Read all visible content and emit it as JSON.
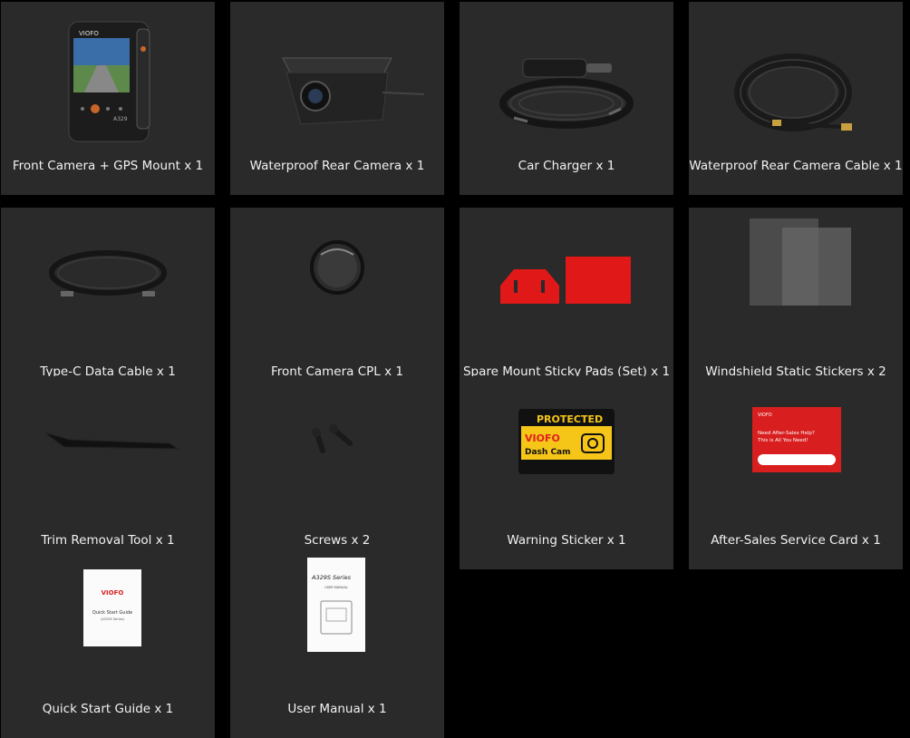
{
  "items": [
    {
      "label": "Front Camera + GPS Mount x 1"
    },
    {
      "label": "Waterproof Rear Camera x 1"
    },
    {
      "label": "Car Charger x 1"
    },
    {
      "label": "Waterproof Rear Camera Cable x 1"
    },
    {
      "label": "Type-C Data Cable x 1"
    },
    {
      "label": "Front Camera CPL x 1"
    },
    {
      "label": "Spare Mount Sticky Pads (Set) x 1"
    },
    {
      "label": "Windshield Static Stickers x 2"
    },
    {
      "label": "Trim Removal Tool x 1"
    },
    {
      "label": "Screws x 2"
    },
    {
      "label": "Warning Sticker x 1"
    },
    {
      "label": "After-Sales Service Card x 1"
    },
    {
      "label": "Quick Start Guide x 1"
    },
    {
      "label": "User Manual x 1"
    }
  ],
  "product_text": {
    "brand": "VIOFO",
    "model_badge": "A329",
    "warning_protected": "PROTECTED",
    "warning_brand": "VIOFO",
    "warning_dashcam": "Dash Cam",
    "card_brand": "VIOFO",
    "card_line1": "Need After-Sales Help?",
    "card_line2": "This is All You Need!",
    "qsg_brand": "VIOFO",
    "qsg_title": "Quick Start Guide",
    "qsg_subtitle": "(A329S Series)",
    "manual_model": "A329S Series",
    "manual_title": "USER MANUAL"
  },
  "colors": {
    "card_bg": "#2a2a2a",
    "page_bg": "#000000",
    "label_text": "#f2f2f2",
    "sticky_red": "#e01818",
    "warning_yellow": "#f5c518",
    "card_red": "#d81e1e"
  }
}
